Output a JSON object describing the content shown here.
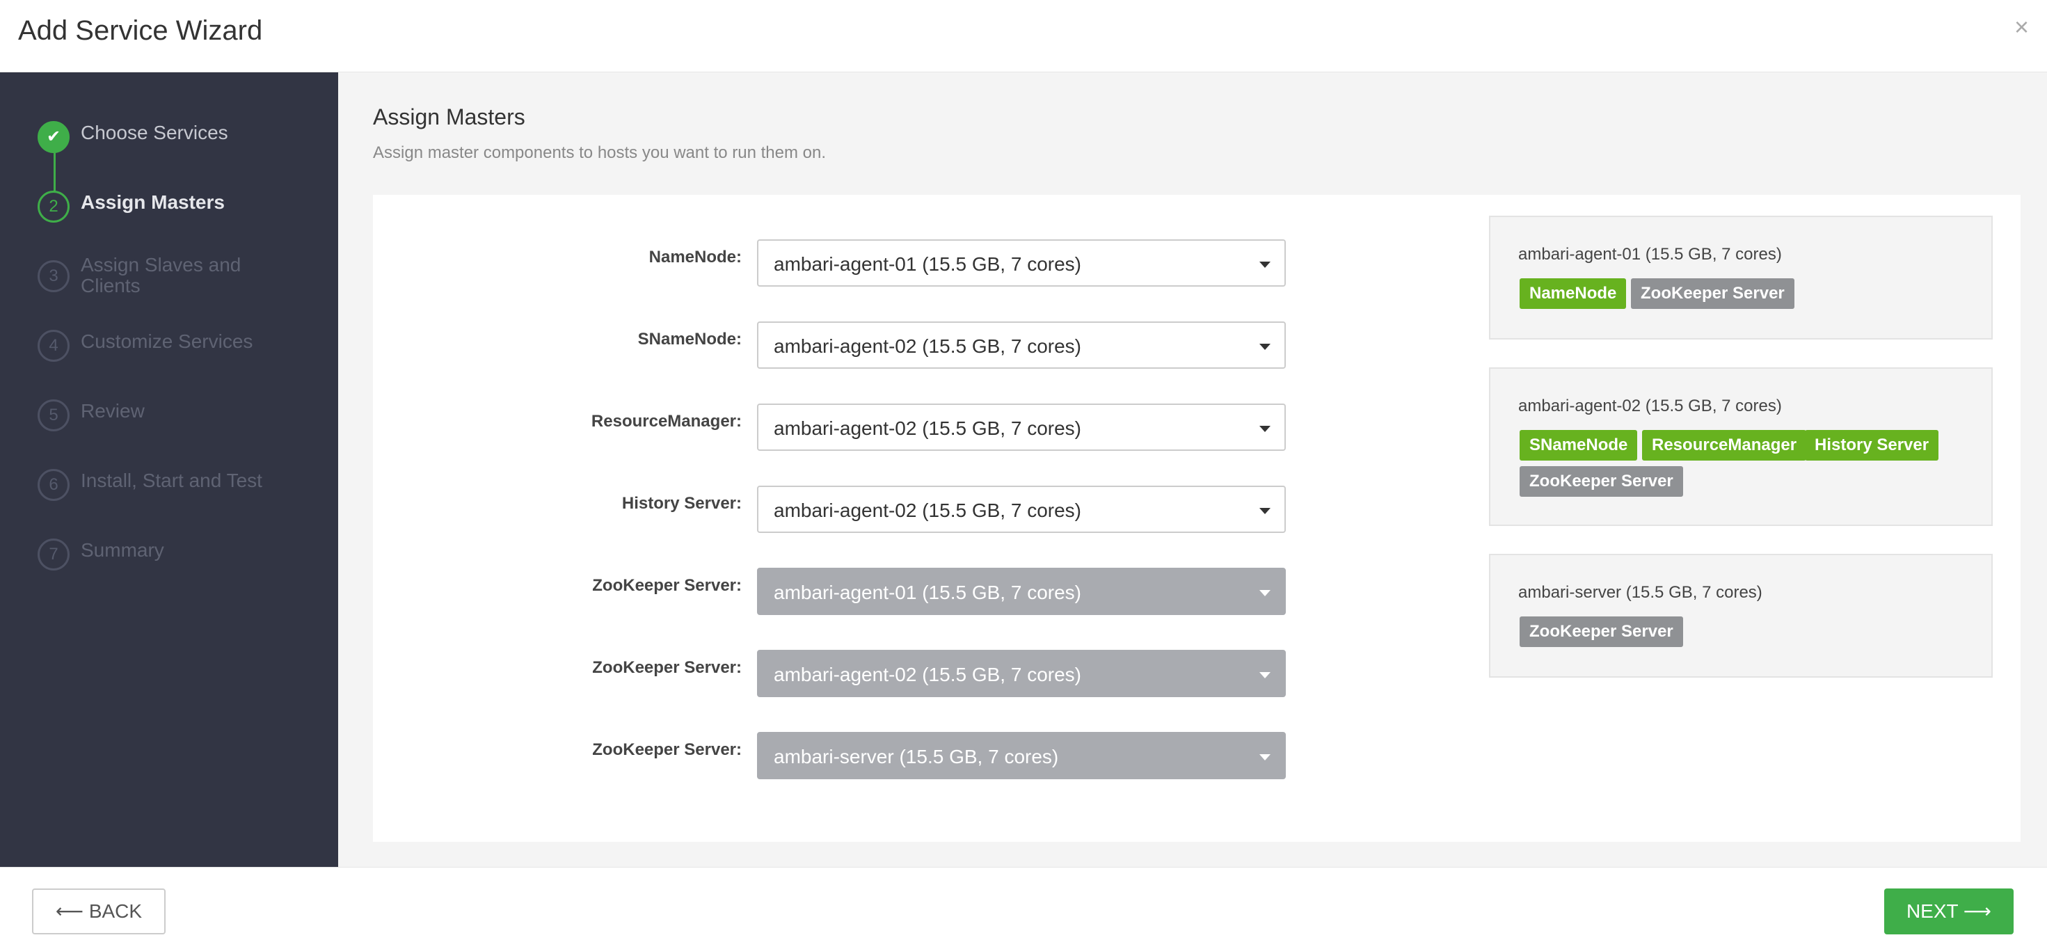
{
  "window": {
    "title": "Add Service Wizard",
    "close_icon": "close-icon"
  },
  "steps": [
    {
      "number": "✔",
      "label": "Choose Services",
      "state": "done"
    },
    {
      "number": "2",
      "label": "Assign Masters",
      "state": "active"
    },
    {
      "number": "3",
      "label": "Assign Slaves and Clients",
      "state": "pending"
    },
    {
      "number": "4",
      "label": "Customize Services",
      "state": "pending"
    },
    {
      "number": "5",
      "label": "Review",
      "state": "pending"
    },
    {
      "number": "6",
      "label": "Install, Start and Test",
      "state": "pending"
    },
    {
      "number": "7",
      "label": "Summary",
      "state": "pending"
    }
  ],
  "main": {
    "title": "Assign Masters",
    "subtitle": "Assign master components to hosts you want to run them on."
  },
  "assignments": [
    {
      "label": "NameNode:",
      "value": "ambari-agent-01 (15.5 GB, 7 cores)",
      "disabled": false
    },
    {
      "label": "SNameNode:",
      "value": "ambari-agent-02 (15.5 GB, 7 cores)",
      "disabled": false
    },
    {
      "label": "ResourceManager:",
      "value": "ambari-agent-02 (15.5 GB, 7 cores)",
      "disabled": false
    },
    {
      "label": "History Server:",
      "value": "ambari-agent-02 (15.5 GB, 7 cores)",
      "disabled": false
    },
    {
      "label": "ZooKeeper Server:",
      "value": "ambari-agent-01 (15.5 GB, 7 cores)",
      "disabled": true
    },
    {
      "label": "ZooKeeper Server:",
      "value": "ambari-agent-02 (15.5 GB, 7 cores)",
      "disabled": true
    },
    {
      "label": "ZooKeeper Server:",
      "value": "ambari-server (15.5 GB, 7 cores)",
      "disabled": true
    }
  ],
  "hosts": [
    {
      "name": "ambari-agent-01 (15.5 GB, 7 cores)",
      "components": [
        {
          "label": "NameNode",
          "color": "green"
        },
        {
          "label": "ZooKeeper Server",
          "color": "gray"
        }
      ]
    },
    {
      "name": "ambari-agent-02 (15.5 GB, 7 cores)",
      "components": [
        {
          "label": "SNameNode",
          "color": "green"
        },
        {
          "label": "ResourceManager",
          "color": "green"
        },
        {
          "label": "History Server",
          "color": "green"
        },
        {
          "label": "ZooKeeper Server",
          "color": "gray"
        }
      ]
    },
    {
      "name": "ambari-server (15.5 GB, 7 cores)",
      "components": [
        {
          "label": "ZooKeeper Server",
          "color": "gray"
        }
      ]
    }
  ],
  "footer": {
    "back_label": "⟵ BACK",
    "next_label": "NEXT ⟶"
  },
  "colors": {
    "accent_green": "#3fae49",
    "tag_green": "#67b21f",
    "tag_gray": "#8f9194",
    "sidebar_bg": "#323544"
  }
}
